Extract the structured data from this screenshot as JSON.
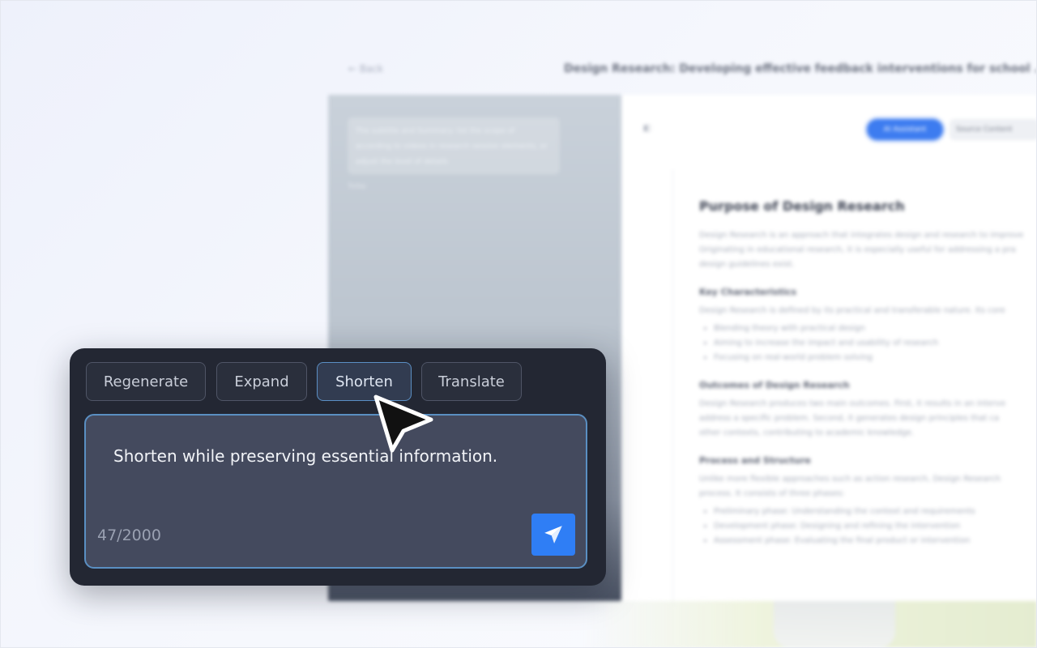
{
  "background": {
    "back_label": "Back",
    "doc_title": "Design Research: Developing effective feedback interventions for school ...",
    "chat_bubble": "The subtitle and Summary: list the scope of according to videos in research session elements, or adjust the level of details",
    "chat_time": "Today",
    "ai_button": "AI Assistant",
    "source_button": "Source Content",
    "heading": "Purpose of Design Research",
    "intro_1": "Design Research is an approach that integrates design and research to improve",
    "intro_2": "Originating in educational research, it is especially useful for addressing a pra",
    "intro_3": "design guidelines exist.",
    "section1_title": "Key Characteristics",
    "section1_text": "Design Research is defined by its practical and transferable nature. Its core",
    "section1_bullets": [
      "Blending theory with practical design",
      "Aiming to increase the impact and usability of research",
      "Focusing on real-world problem solving"
    ],
    "section2_title": "Outcomes of Design Research",
    "section2_lines": [
      "Design Research produces two main outcomes. First, it results in an interve",
      "address a specific problem. Second, it generates design principles that ca",
      "other contexts, contributing to academic knowledge."
    ],
    "section3_title": "Process and Structure",
    "section3_lines": [
      "Unlike more flexible approaches such as action research, Design Research",
      "process. It consists of three phases:"
    ],
    "section3_bullets": [
      "Preliminary phase: Understanding the context and requirements",
      "Development phase: Designing and refining the intervention",
      "Assessment phase: Evaluating the final product or intervention"
    ]
  },
  "panel": {
    "chips": [
      {
        "label": "Regenerate"
      },
      {
        "label": "Expand"
      },
      {
        "label": "Shorten",
        "active": true
      },
      {
        "label": "Translate"
      }
    ],
    "prompt_text": "Shorten while preserving essential information.",
    "counter": "47/2000",
    "send_icon": "send-icon"
  },
  "colors": {
    "panel_bg": "#232733",
    "input_bg": "#444a5e",
    "input_border": "#5a8fc2",
    "send_button": "#2f7ef5",
    "accent_blue": "#3d7cf0"
  }
}
